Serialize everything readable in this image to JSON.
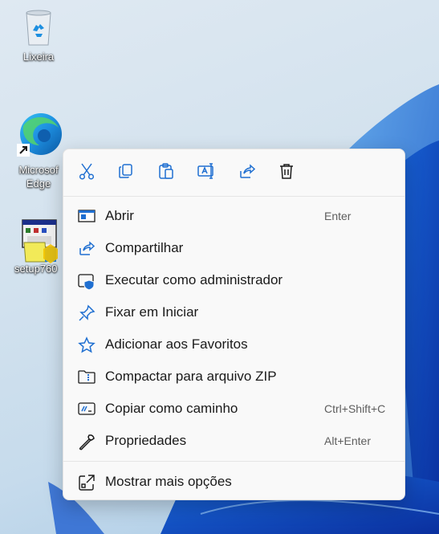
{
  "desktop": {
    "icons": [
      {
        "label": "Lixeira"
      },
      {
        "label": "Microsof Edge"
      },
      {
        "label": "setup760"
      }
    ]
  },
  "context_menu": {
    "toolbar": [
      {
        "icon": "cut-icon"
      },
      {
        "icon": "copy-icon"
      },
      {
        "icon": "paste-icon"
      },
      {
        "icon": "rename-icon"
      },
      {
        "icon": "share-icon"
      },
      {
        "icon": "delete-icon"
      }
    ],
    "items": [
      {
        "label": "Abrir",
        "accel": "Enter",
        "icon": "open-icon"
      },
      {
        "label": "Compartilhar",
        "accel": "",
        "icon": "share-icon"
      },
      {
        "label": "Executar como administrador",
        "accel": "",
        "icon": "admin-shield-icon"
      },
      {
        "label": "Fixar em Iniciar",
        "accel": "",
        "icon": "pin-icon"
      },
      {
        "label": "Adicionar aos Favoritos",
        "accel": "",
        "icon": "star-icon"
      },
      {
        "label": "Compactar para arquivo ZIP",
        "accel": "",
        "icon": "zip-folder-icon"
      },
      {
        "label": "Copiar como caminho",
        "accel": "Ctrl+Shift+C",
        "icon": "copy-path-icon"
      },
      {
        "label": "Propriedades",
        "accel": "Alt+Enter",
        "icon": "wrench-icon"
      },
      {
        "label": "Mostrar mais opções",
        "accel": "",
        "icon": "more-options-icon"
      }
    ]
  },
  "colors": {
    "accent": "#1f6fd1",
    "menu_bg": "#f9f9f9",
    "text": "#1a1a1a",
    "accel_text": "#5d5d5d"
  }
}
